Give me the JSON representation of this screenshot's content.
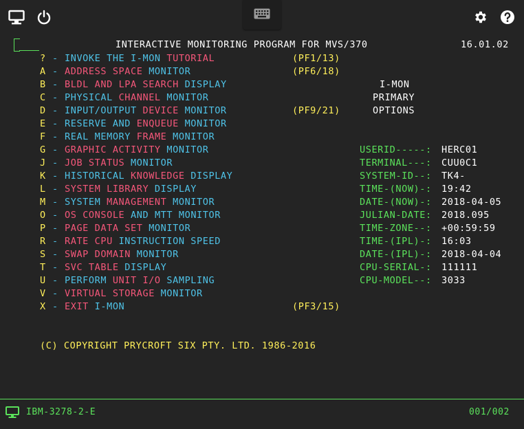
{
  "toolbar": {
    "left_icons": [
      "monitor-icon",
      "power-icon"
    ],
    "center_icon": "keyboard-icon",
    "right_icons": [
      "gear-icon",
      "help-icon"
    ]
  },
  "terminal": {
    "title": "INTERACTIVE MONITORING PROGRAM FOR MVS/370",
    "version": "16.01.02",
    "options": [
      {
        "key": "?",
        "sep": "-",
        "segments": [
          [
            "INVOKE ",
            "c"
          ],
          [
            "THE ",
            "c"
          ],
          [
            "I-MON ",
            "c"
          ],
          [
            "TUTORIAL",
            "p"
          ]
        ],
        "pf": "(PF1/13)"
      },
      {
        "key": "A",
        "sep": "-",
        "segments": [
          [
            "ADDRESS ",
            "p"
          ],
          [
            "SPACE ",
            "p"
          ],
          [
            "MONITOR",
            "c"
          ]
        ],
        "pf": "(PF6/18)"
      },
      {
        "key": "B",
        "sep": "-",
        "segments": [
          [
            "BLDL ",
            "p"
          ],
          [
            "AND ",
            "p"
          ],
          [
            "LPA ",
            "p"
          ],
          [
            "SEARCH ",
            "p"
          ],
          [
            "DISPLAY",
            "c"
          ]
        ],
        "pf": ""
      },
      {
        "key": "C",
        "sep": "-",
        "segments": [
          [
            "PHYSICAL ",
            "c"
          ],
          [
            "CHANNEL ",
            "p"
          ],
          [
            "MONITOR",
            "c"
          ]
        ],
        "pf": ""
      },
      {
        "key": "D",
        "sep": "-",
        "segments": [
          [
            "INPUT/OUTPUT ",
            "c"
          ],
          [
            "DEVICE ",
            "p"
          ],
          [
            "MONITOR",
            "c"
          ]
        ],
        "pf": "(PF9/21)"
      },
      {
        "key": "E",
        "sep": "-",
        "segments": [
          [
            "RESERVE ",
            "c"
          ],
          [
            "AND ",
            "c"
          ],
          [
            "ENQUEUE ",
            "p"
          ],
          [
            "MONITOR",
            "c"
          ]
        ],
        "pf": ""
      },
      {
        "key": "F",
        "sep": "-",
        "segments": [
          [
            "REAL ",
            "c"
          ],
          [
            "MEMORY ",
            "c"
          ],
          [
            "FRAME ",
            "p"
          ],
          [
            "MONITOR",
            "c"
          ]
        ],
        "pf": ""
      },
      {
        "key": "G",
        "sep": "-",
        "segments": [
          [
            "GRAPHIC ",
            "p"
          ],
          [
            "ACTIVITY ",
            "p"
          ],
          [
            "MONITOR",
            "c"
          ]
        ],
        "pf": ""
      },
      {
        "key": "J",
        "sep": "-",
        "segments": [
          [
            "JOB ",
            "p"
          ],
          [
            "STATUS ",
            "p"
          ],
          [
            "MONITOR",
            "c"
          ]
        ],
        "pf": ""
      },
      {
        "key": "K",
        "sep": "-",
        "segments": [
          [
            "HISTORICAL ",
            "c"
          ],
          [
            "KNOWLEDGE ",
            "p"
          ],
          [
            "DISPLAY",
            "c"
          ]
        ],
        "pf": ""
      },
      {
        "key": "L",
        "sep": "-",
        "segments": [
          [
            "SYSTEM ",
            "p"
          ],
          [
            "LIBRARY ",
            "p"
          ],
          [
            "DISPLAY",
            "c"
          ]
        ],
        "pf": ""
      },
      {
        "key": "M",
        "sep": "-",
        "segments": [
          [
            "SYSTEM ",
            "c"
          ],
          [
            "MANAGEMENT ",
            "p"
          ],
          [
            "MONITOR",
            "c"
          ]
        ],
        "pf": ""
      },
      {
        "key": "O",
        "sep": "-",
        "segments": [
          [
            "OS ",
            "p"
          ],
          [
            "CONSOLE ",
            "p"
          ],
          [
            "AND ",
            "c"
          ],
          [
            "MTT ",
            "c"
          ],
          [
            "MONITOR",
            "c"
          ]
        ],
        "pf": ""
      },
      {
        "key": "P",
        "sep": "-",
        "segments": [
          [
            "PAGE ",
            "p"
          ],
          [
            "DATA ",
            "p"
          ],
          [
            "SET ",
            "p"
          ],
          [
            "MONITOR",
            "c"
          ]
        ],
        "pf": ""
      },
      {
        "key": "R",
        "sep": "-",
        "segments": [
          [
            "RATE ",
            "p"
          ],
          [
            "CPU ",
            "p"
          ],
          [
            "INSTRUCTION ",
            "c"
          ],
          [
            "SPEED",
            "c"
          ]
        ],
        "pf": ""
      },
      {
        "key": "S",
        "sep": "-",
        "segments": [
          [
            "SWAP ",
            "p"
          ],
          [
            "DOMAIN ",
            "p"
          ],
          [
            "MONITOR",
            "c"
          ]
        ],
        "pf": ""
      },
      {
        "key": "T",
        "sep": "-",
        "segments": [
          [
            "SVC ",
            "p"
          ],
          [
            "TABLE ",
            "p"
          ],
          [
            "DISPLAY",
            "c"
          ]
        ],
        "pf": ""
      },
      {
        "key": "U",
        "sep": "-",
        "segments": [
          [
            "PERFORM ",
            "c"
          ],
          [
            "UNIT ",
            "p"
          ],
          [
            "I/O ",
            "p"
          ],
          [
            "SAMPLING",
            "c"
          ]
        ],
        "pf": ""
      },
      {
        "key": "V",
        "sep": "-",
        "segments": [
          [
            "VIRTUAL ",
            "p"
          ],
          [
            "STORAGE ",
            "p"
          ],
          [
            "MONITOR",
            "c"
          ]
        ],
        "pf": ""
      },
      {
        "key": "X",
        "sep": "-",
        "segments": [
          [
            "EXIT ",
            "p"
          ],
          [
            "I-MON",
            "c"
          ]
        ],
        "pf": "(PF3/15)"
      }
    ],
    "panel_title": [
      "I-MON",
      "PRIMARY",
      "OPTIONS"
    ],
    "info": [
      {
        "label": "USERID-----:",
        "value": "HERC01"
      },
      {
        "label": "TERMINAL---:",
        "value": "CUU0C1"
      },
      {
        "label": "SYSTEM-ID--:",
        "value": "TK4-"
      },
      {
        "label": "TIME-(NOW)-:",
        "value": "19:42"
      },
      {
        "label": "DATE-(NOW)-:",
        "value": "2018-04-05"
      },
      {
        "label": "JULIAN-DATE:",
        "value": "2018.095"
      },
      {
        "label": "TIME-ZONE--:",
        "value": "+00:59:59"
      },
      {
        "label": "TIME-(IPL)-:",
        "value": "16:03"
      },
      {
        "label": "DATE-(IPL)-:",
        "value": "2018-04-04"
      },
      {
        "label": "CPU-SERIAL-:",
        "value": "111111"
      },
      {
        "label": "CPU-MODEL--:",
        "value": "3033"
      }
    ],
    "copyright": "(C) COPYRIGHT PRYCROFT SIX PTY. LTD. 1986-2016"
  },
  "statusbar": {
    "terminal_type": "IBM-3278-2-E",
    "cursor_position": "001/002"
  },
  "colors": {
    "background": "#242424",
    "white": "#ffffff",
    "yellow": "#ffef5a",
    "green": "#5be25b",
    "cyan": "#4fc3e8",
    "pink": "#f5577a"
  }
}
